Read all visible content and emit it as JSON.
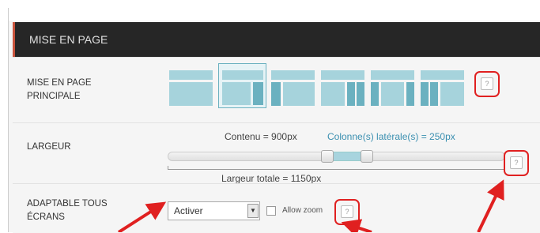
{
  "header": {
    "title": "MISE EN PAGE"
  },
  "rows": {
    "main_layout": {
      "label_line1": "MISE EN PAGE",
      "label_line2": "PRINCIPALE",
      "options": [
        "full-width",
        "content-right-sidebar",
        "left-sidebar-content",
        "content-two-sidebars",
        "sidebar-content-sidebar",
        "two-sidebars-content"
      ],
      "selected_index": 1,
      "help": "?"
    },
    "width": {
      "label": "LARGEUR",
      "content_text": "Contenu = 900px",
      "sidebar_text": "Colonne(s) latérale(s) = 250px",
      "total_text": "Largeur totale = 1150px",
      "help": "?"
    },
    "responsive": {
      "label_line1": "ADAPTABLE TOUS",
      "label_line2": "ÉCRANS",
      "select_value": "Activer",
      "allow_zoom_label": "Allow zoom",
      "help": "?"
    }
  },
  "colors": {
    "accent": "#c9533d",
    "header_bg": "#262626",
    "layout_light": "#a6d3dc",
    "layout_dark": "#6bb1c0",
    "annotation": "#e02020",
    "sidebar_text": "#3a8fb0"
  },
  "icons": {
    "help": "question-mark-icon",
    "dropdown": "dropdown-arrow-icon",
    "annotation": "red-arrow-icon"
  }
}
